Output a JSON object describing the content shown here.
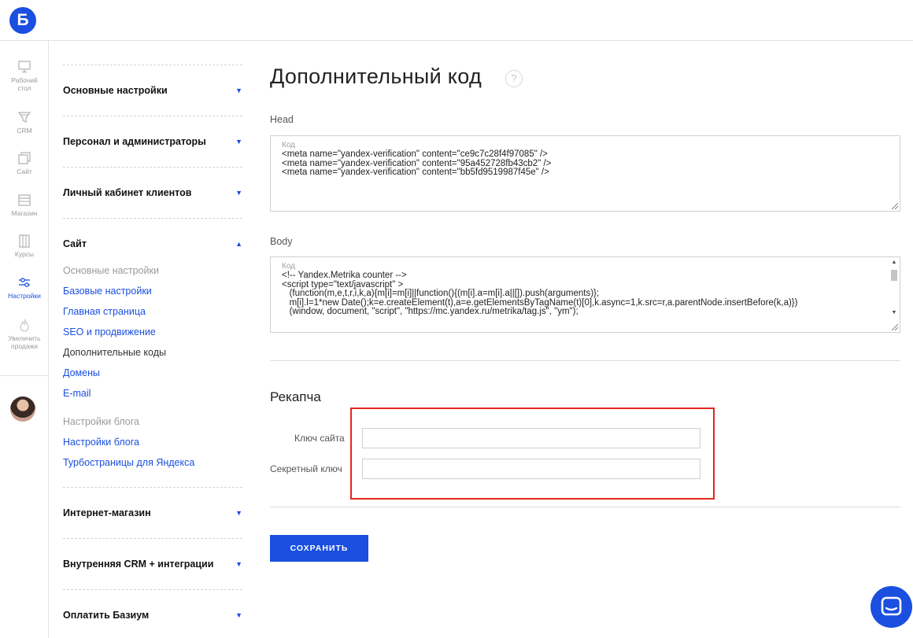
{
  "app": {
    "logo_letter": "Б",
    "brand_color": "#1a4fe0",
    "accent_red": "#e3261f"
  },
  "rail": {
    "items": [
      {
        "label_line1": "Рабочий",
        "label_line2": "стол",
        "icon": "monitor-icon"
      },
      {
        "label_line1": "CRM",
        "label_line2": "",
        "icon": "funnel-icon"
      },
      {
        "label_line1": "Сайт",
        "label_line2": "",
        "icon": "site-pages-icon"
      },
      {
        "label_line1": "Магазин",
        "label_line2": "",
        "icon": "shop-icon"
      },
      {
        "label_line1": "Курсы",
        "label_line2": "",
        "icon": "courses-icon"
      },
      {
        "label_line1": "Настройки",
        "label_line2": "",
        "icon": "sliders-icon",
        "active": true
      },
      {
        "label_line1": "Увеличить",
        "label_line2": "продажи",
        "icon": "flame-icon"
      }
    ],
    "avatar_icon": "user-avatar"
  },
  "menu": {
    "sections": [
      {
        "title": "Основные настройки",
        "arrow": "▼"
      },
      {
        "title": "Персонал и администраторы",
        "arrow": "▼"
      },
      {
        "title": "Личный кабинет клиентов",
        "arrow": "▼"
      },
      {
        "title": "Сайт",
        "arrow": "▲",
        "expanded": true
      },
      {
        "title": "Интернет-магазин",
        "arrow": "▼"
      },
      {
        "title": "Внутренняя CRM + интеграции",
        "arrow": "▼"
      },
      {
        "title": "Оплатить Базиум",
        "arrow": "▼"
      }
    ],
    "site_group_header": "Основные настройки",
    "site_links": [
      "Базовые настройки",
      "Главная страница",
      "SEO и продвижение"
    ],
    "site_current": "Дополнительные коды",
    "site_links_2": [
      "Домены",
      "E-mail"
    ],
    "blog_group_header": "Настройки блога",
    "blog_links": [
      "Настройки блога",
      "Турбостраницы для Яндекса"
    ]
  },
  "main": {
    "title": "Дополнительный код",
    "help_icon": "?",
    "head": {
      "label": "Head",
      "placeholder": "Код",
      "lines": [
        "<meta name=\"yandex-verification\" content=\"ce9c7c28f4f97085\" />",
        "<meta name=\"yandex-verification\" content=\"95a452728fb43cb2\" />",
        "<meta name=\"yandex-verification\" content=\"bb5fd9519987f45e\" />"
      ]
    },
    "body": {
      "label": "Body",
      "placeholder": "Код",
      "lines": [
        "<!-- Yandex.Metrika counter -->",
        "<script type=\"text/javascript\" >",
        "   (function(m,e,t,r,i,k,a){m[i]=m[i]||function(){(m[i].a=m[i].a||[]).push(arguments)};",
        "   m[i].l=1*new Date();k=e.createElement(t),a=e.getElementsByTagName(t)[0],k.async=1,k.src=r,a.parentNode.insertBefore(k,a)})",
        "   (window, document, \"script\", \"https://mc.yandex.ru/metrika/tag.js\", \"ym\");"
      ]
    },
    "recaptcha": {
      "title": "Рекапча",
      "site_key_label": "Ключ сайта",
      "site_key_value": "",
      "secret_key_label": "Секретный ключ",
      "secret_key_value": ""
    },
    "save_label": "СОХРАНИТЬ"
  },
  "chat": {
    "icon": "chat-bubble-icon"
  }
}
